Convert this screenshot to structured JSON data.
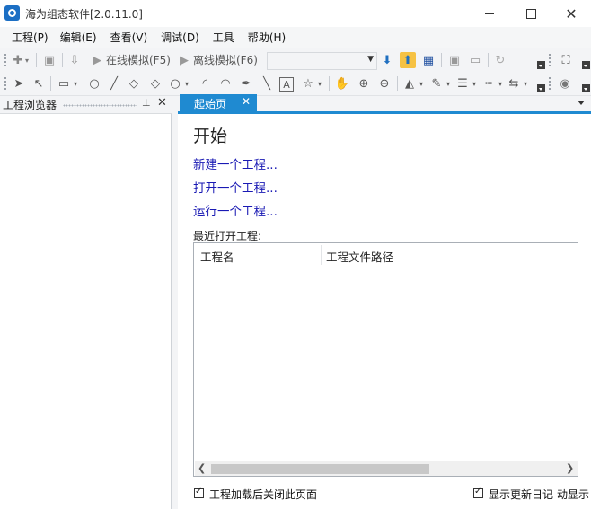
{
  "window": {
    "title": "海为组态软件[2.0.11.0]"
  },
  "menu": [
    "工程(P)",
    "编辑(E)",
    "查看(V)",
    "调试(D)",
    "工具",
    "帮助(H)"
  ],
  "toolbar": {
    "online_sim": "在线模拟(F5)",
    "offline_sim": "离线模拟(F6)"
  },
  "side_panel": {
    "title": "工程浏览器"
  },
  "tab": {
    "label": "起始页"
  },
  "start_page": {
    "heading": "开始",
    "links": [
      "新建一个工程...",
      "打开一个工程...",
      "运行一个工程..."
    ],
    "recent_label": "最近打开工程:",
    "columns": [
      "工程名",
      "工程文件路径"
    ]
  },
  "footer": {
    "close_after_load": "工程加载后关闭此页面",
    "show_changelog": "显示更新日记",
    "auto_show": "动显示"
  },
  "colors": {
    "accent": "#1f8ad1",
    "link": "#1a1ab4"
  }
}
